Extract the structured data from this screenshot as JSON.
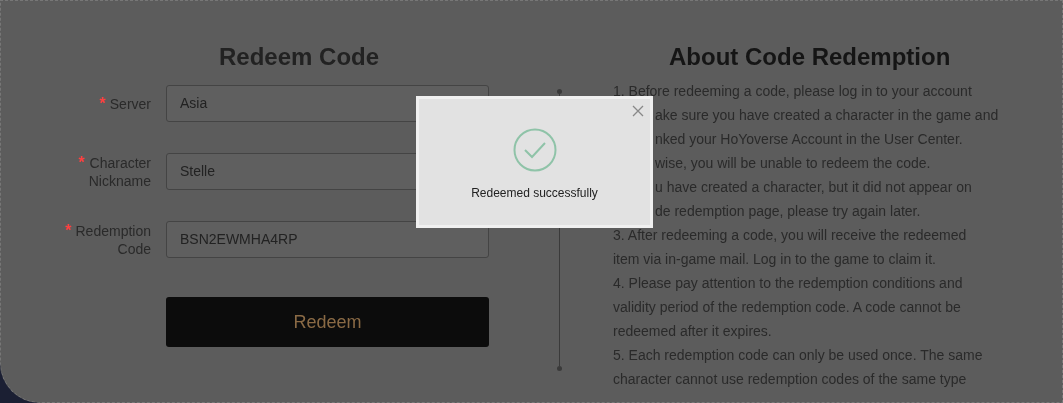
{
  "form": {
    "title": "Redeem Code",
    "fields": [
      {
        "label_lines": [
          "Server"
        ],
        "required_mark": "*",
        "value": "Asia"
      },
      {
        "label_lines": [
          "Character",
          "Nickname"
        ],
        "required_mark": "*",
        "value": "Stelle"
      },
      {
        "label_lines": [
          "Redemption",
          "Code"
        ],
        "required_mark": "*",
        "value": "BSN2EWMHA4RP"
      }
    ],
    "submit": "Redeem"
  },
  "about": {
    "title": "About Code Redemption",
    "lines": [
      {
        "text": "1. Before redeeming a code, please log in to your account",
        "kind": "full"
      },
      {
        "text": "ake sure you have created a character in the game and",
        "kind": "partial"
      },
      {
        "text": "nked your HoYoverse Account in the User Center.",
        "kind": "partial"
      },
      {
        "text": "wise, you will be unable to redeem the code.",
        "kind": "partial"
      },
      {
        "text": "u have created a character, but it did not appear on",
        "kind": "partial"
      },
      {
        "text": "de redemption page, please try again later.",
        "kind": "partial"
      },
      {
        "text": "3. After redeeming a code, you will receive the redeemed",
        "kind": "full"
      },
      {
        "text": "item via in-game mail. Log in to the game to claim it.",
        "kind": "full"
      },
      {
        "text": "4. Please pay attention to the redemption conditions and",
        "kind": "full"
      },
      {
        "text": "validity period of the redemption code. A code cannot be",
        "kind": "full"
      },
      {
        "text": "redeemed after it expires.",
        "kind": "full"
      },
      {
        "text": "5. Each redemption code can only be used once. The same",
        "kind": "full"
      },
      {
        "text": "character cannot use redemption codes of the same type",
        "kind": "full"
      }
    ]
  },
  "toast": {
    "message": "Redeemed successfully"
  }
}
